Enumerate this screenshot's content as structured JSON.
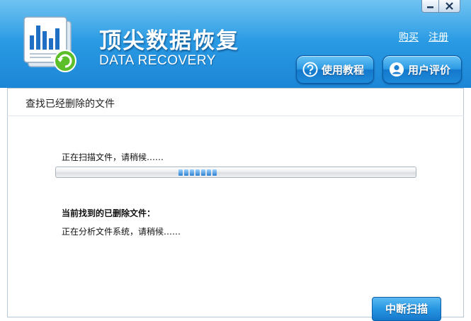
{
  "app": {
    "title_cn": "顶尖数据恢复",
    "title_en": "DATA RECOVERY"
  },
  "top_links": {
    "buy": "购买",
    "register": "注册"
  },
  "buttons": {
    "help": "使用教程",
    "evaluate": "用户评价",
    "stop": "中断扫描"
  },
  "panel": {
    "title": "查找已经删除的文件",
    "scan_status": "正在扫描文件，请稍候……",
    "found_label": "当前找到的已删除文件：",
    "analyze_status": "正在分析文件系统，请稍候……"
  },
  "progress": {
    "style": "marquee",
    "position_fraction": 0.34
  },
  "icons": {
    "logo": "data-recovery-logo-icon",
    "help": "question-icon",
    "evaluate": "user-icon",
    "minimize": "minimize-icon",
    "close": "close-icon"
  },
  "colors": {
    "header_top": "#4fb5ee",
    "header_bottom": "#1c86d6",
    "progress_fill": "#2c7fd3",
    "text": "#111111"
  }
}
